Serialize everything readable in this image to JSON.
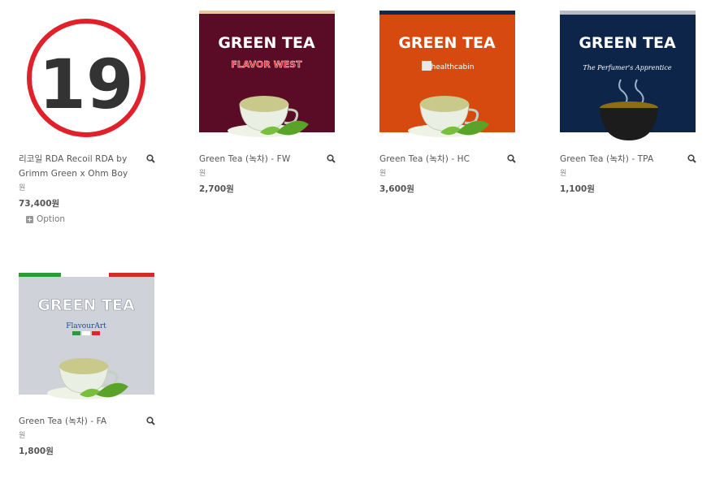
{
  "products": [
    {
      "name": "리코일 RDA Recoil RDA by Grimm Green x Ohm Boy",
      "unit": "원",
      "price": "73,400원",
      "option_label": "Option",
      "image": {
        "type": "age-19-badge",
        "badge_text": "19",
        "ring_color": "#e0202a",
        "text_color": "#333333"
      }
    },
    {
      "name": "Green Tea (녹차) - FW",
      "unit": "원",
      "price": "2,700원",
      "image": {
        "type": "tea-label",
        "title": "GREEN TEA",
        "brand": "FLAVOR WEST",
        "bg": "#5a0c27",
        "top_bar": "#e9c7a0"
      }
    },
    {
      "name": "Green Tea (녹차) - HC",
      "unit": "원",
      "price": "3,600원",
      "image": {
        "type": "tea-label",
        "title": "GREEN TEA",
        "brand": "healthcabin",
        "bg": "#d64a0f",
        "top_bar": "#0d2a4c"
      }
    },
    {
      "name": "Green Tea (녹차) - TPA",
      "unit": "원",
      "price": "1,100원",
      "image": {
        "type": "tea-label",
        "title": "GREEN TEA",
        "brand": "The Perfumer's Apprentice",
        "bg": "#0c2549",
        "top_bar": "#b8bcc4"
      }
    },
    {
      "name": "Green Tea (녹차) - FA",
      "unit": "원",
      "price": "1,800원",
      "image": {
        "type": "tea-label",
        "title": "GREEN TEA",
        "brand": "FlavourArt",
        "bg": "#cfd2d9",
        "top_bar": "#ffffff"
      }
    }
  ]
}
